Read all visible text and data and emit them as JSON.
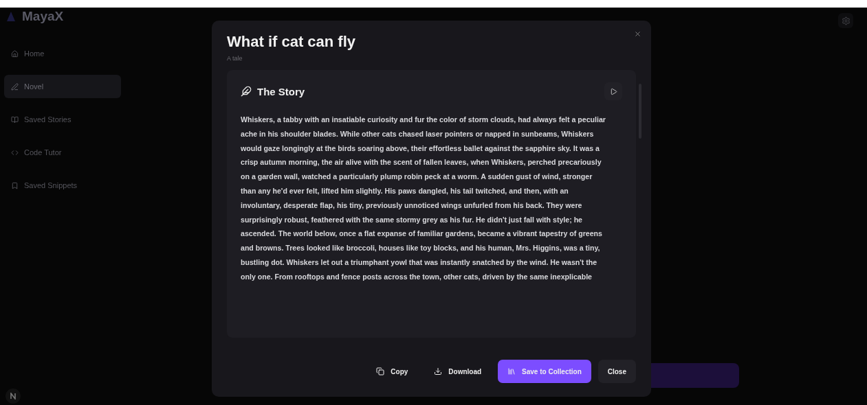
{
  "app": {
    "logo": "MayaX"
  },
  "sidebar": {
    "items": [
      {
        "label": "Home",
        "selected": false
      },
      {
        "label": "Novel",
        "selected": true
      },
      {
        "label": "Saved Stories",
        "selected": false
      },
      {
        "label": "Code Tutor",
        "selected": false
      },
      {
        "label": "Saved Snippets",
        "selected": false
      }
    ]
  },
  "modal": {
    "title": "What if cat can fly",
    "subtitle": "A tale",
    "story_heading": "The Story",
    "story_text": "Whiskers, a tabby with an insatiable curiosity and fur the color of storm clouds, had always felt a peculiar ache in his shoulder blades. While other cats chased laser pointers or napped in sunbeams, Whiskers would gaze longingly at the birds soaring above, their effortless ballet against the sapphire sky. It was a crisp autumn morning, the air alive with the scent of fallen leaves, when Whiskers, perched precariously on a garden wall, watched a particularly plump robin peck at a worm. A sudden gust of wind, stronger than any he'd ever felt, lifted him slightly. His paws dangled, his tail twitched, and then, with an involuntary, desperate flap, his tiny, previously unnoticed wings unfurled from his back. They were surprisingly robust, feathered with the same stormy grey as his fur. He didn't just fall with style; he ascended. The world below, once a flat expanse of familiar gardens, became a vibrant tapestry of greens and browns. Trees looked like broccoli, houses like toy blocks, and his human, Mrs. Higgins, was a tiny, bustling dot. Whiskers let out a triumphant yowl that was instantly snatched by the wind. He wasn't the only one. From rooftops and fence posts across the town, other cats, driven by the same inexplicable",
    "buttons": [
      {
        "label": "Copy",
        "kind": "copy"
      },
      {
        "label": "Download",
        "kind": "download"
      },
      {
        "label": "Save to Collection",
        "kind": "primary"
      },
      {
        "label": "Close",
        "kind": "secondary"
      }
    ]
  }
}
